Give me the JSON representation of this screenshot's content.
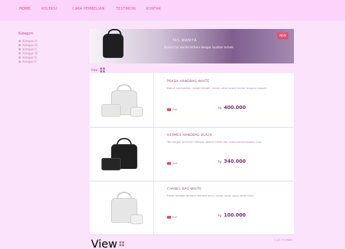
{
  "nav": {
    "items": [
      "HOME",
      "KOLEKSI",
      "CARA PEMBELIAN",
      "TESTIMONI",
      "KONTAK"
    ]
  },
  "sidebar": {
    "title": "Kategori",
    "items": [
      "Kategori A",
      "Kategori B",
      "Kategori C",
      "Kategori D",
      "Kategori E",
      "Kategori F"
    ]
  },
  "banner": {
    "title": "TAS WANITA",
    "subtitle": "Koleksi tas wanita terbaru dengan kualitas terbaik",
    "badge": "NEW"
  },
  "view_toggle": {
    "label": "View"
  },
  "products": [
    {
      "title": "PRADA HANDBAG WHITE",
      "desc": "Bahan berkualitas, model elegan, cocok untuk acara formal maupun kasual.",
      "cart_label": "Beli",
      "price_prefix": "Rp",
      "price": "400.000"
    },
    {
      "title": "HERMES HANDBAG BLACK",
      "desc": "Tas tangan premium dengan desain klasik dan ruang penyimpanan luas.",
      "cart_label": "Beli",
      "price_prefix": "Rp",
      "price": "340.000"
    },
    {
      "title": "CHANEL BAG WHITE",
      "desc": "Paket lengkap dengan dompet kecil, cocok untuk gaya sehari-hari.",
      "cart_label": "Beli",
      "price_prefix": "Rp",
      "price": "100.000"
    }
  ],
  "pager": {
    "text": "1 | 2 | 3 | Next"
  },
  "colors": {
    "background": "#fbe3fb",
    "nav_active": "#ff2e6f",
    "accent": "#ff3f62"
  }
}
